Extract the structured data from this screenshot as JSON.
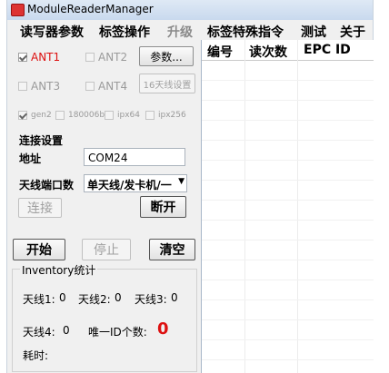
{
  "window": {
    "title": "ModuleReaderManager"
  },
  "menu": {
    "items": [
      {
        "label": "读写器参数",
        "disabled": false
      },
      {
        "label": "标签操作",
        "disabled": false
      },
      {
        "label": "升级",
        "disabled": true
      },
      {
        "label": "标签特殊指令",
        "disabled": false
      },
      {
        "label": "测试",
        "disabled": false
      },
      {
        "label": "关于",
        "disabled": false
      }
    ]
  },
  "antennas": {
    "ant1": {
      "label": "ANT1",
      "checked": true
    },
    "ant2": {
      "label": "ANT2",
      "checked": false
    },
    "ant3": {
      "label": "ANT3",
      "checked": false
    },
    "ant4": {
      "label": "ANT4",
      "checked": false
    },
    "params_button": "参数...",
    "ant16_button": "16天线设置"
  },
  "protocols": [
    {
      "label": "gen2",
      "checked": true
    },
    {
      "label": "180006b",
      "checked": false
    },
    {
      "label": "ipx64",
      "checked": false
    },
    {
      "label": "ipx256",
      "checked": false
    }
  ],
  "connection": {
    "section_title": "连接设置",
    "address_label": "地址",
    "address_value": "COM24",
    "port_label": "天线端口数",
    "port_value": "单天线/发卡机/一",
    "connect_button": "连接",
    "disconnect_button": "断开"
  },
  "controls": {
    "start_button": "开始",
    "stop_button": "停止",
    "clear_button": "清空"
  },
  "inventory": {
    "title": "Inventory统计",
    "ant1_label": "天线1:",
    "ant1_value": "0",
    "ant2_label": "天线2:",
    "ant2_value": "0",
    "ant3_label": "天线3:",
    "ant3_value": "0",
    "ant4_label": "天线4:",
    "ant4_value": "0",
    "unique_label": "唯一ID个数:",
    "unique_value": "0",
    "elapsed_label": "耗时:"
  },
  "table": {
    "columns": [
      "编号",
      "读次数",
      "EPC ID"
    ],
    "rows": []
  },
  "colors": {
    "accent_red": "#dd1111",
    "title_gradient": "#c9d9ee"
  }
}
